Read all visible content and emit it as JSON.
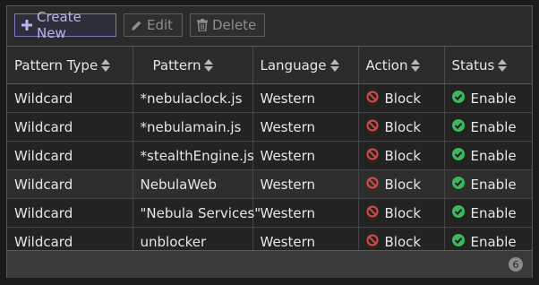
{
  "toolbar": {
    "create_label": "Create New",
    "edit_label": "Edit",
    "delete_label": "Delete"
  },
  "columns": [
    "Pattern Type",
    "Pattern",
    "Language",
    "Action",
    "Status"
  ],
  "rows": [
    {
      "type": "Wildcard",
      "pattern": "*nebulaclock.js",
      "language": "Western",
      "action": "Block",
      "status": "Enable"
    },
    {
      "type": "Wildcard",
      "pattern": "*nebulamain.js",
      "language": "Western",
      "action": "Block",
      "status": "Enable"
    },
    {
      "type": "Wildcard",
      "pattern": "*stealthEngine.js",
      "language": "Western",
      "action": "Block",
      "status": "Enable"
    },
    {
      "type": "Wildcard",
      "pattern": "NebulaWeb",
      "language": "Western",
      "action": "Block",
      "status": "Enable"
    },
    {
      "type": "Wildcard",
      "pattern": "\"Nebula Services\"",
      "language": "Western",
      "action": "Block",
      "status": "Enable"
    },
    {
      "type": "Wildcard",
      "pattern": "unblocker",
      "language": "Western",
      "action": "Block",
      "status": "Enable"
    }
  ],
  "footer": {
    "count": "6"
  },
  "icons": {
    "create": "plus-icon",
    "edit": "pencil-icon",
    "delete": "trash-icon",
    "action": "block-icon",
    "status": "check-circle-icon"
  },
  "colors": {
    "block": "#e04848",
    "enable": "#3db55a",
    "primary": "#7a7ac2"
  }
}
